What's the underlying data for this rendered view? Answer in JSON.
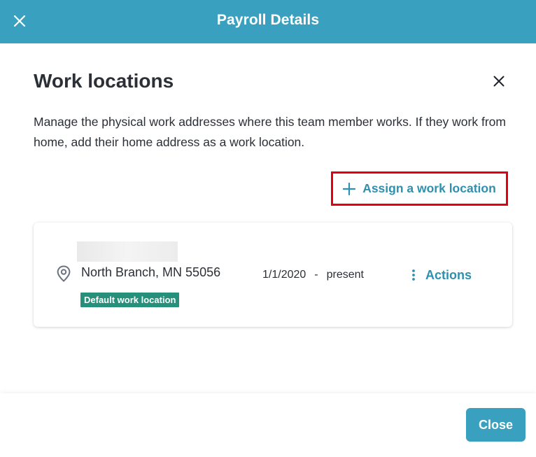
{
  "header": {
    "title": "Payroll Details",
    "close_icon": "close-icon"
  },
  "panel": {
    "title": "Work locations",
    "description": "Manage the physical work addresses where this team member works. If they work from home, add their home address as a work location.",
    "assign_label": "Assign a work location",
    "assign_icon": "plus-icon"
  },
  "location": {
    "address": "North Branch, MN 55056",
    "badge": "Default work location",
    "start_date": "1/1/2020",
    "separator": "-",
    "end_date": "present",
    "actions_label": "Actions",
    "icon": "map-pin-icon"
  },
  "footer": {
    "close_label": "Close"
  },
  "colors": {
    "header_bg": "#3aa0bf",
    "accent_text": "#2f8fae",
    "badge_bg": "#26907a",
    "highlight_border": "#e3000f"
  }
}
